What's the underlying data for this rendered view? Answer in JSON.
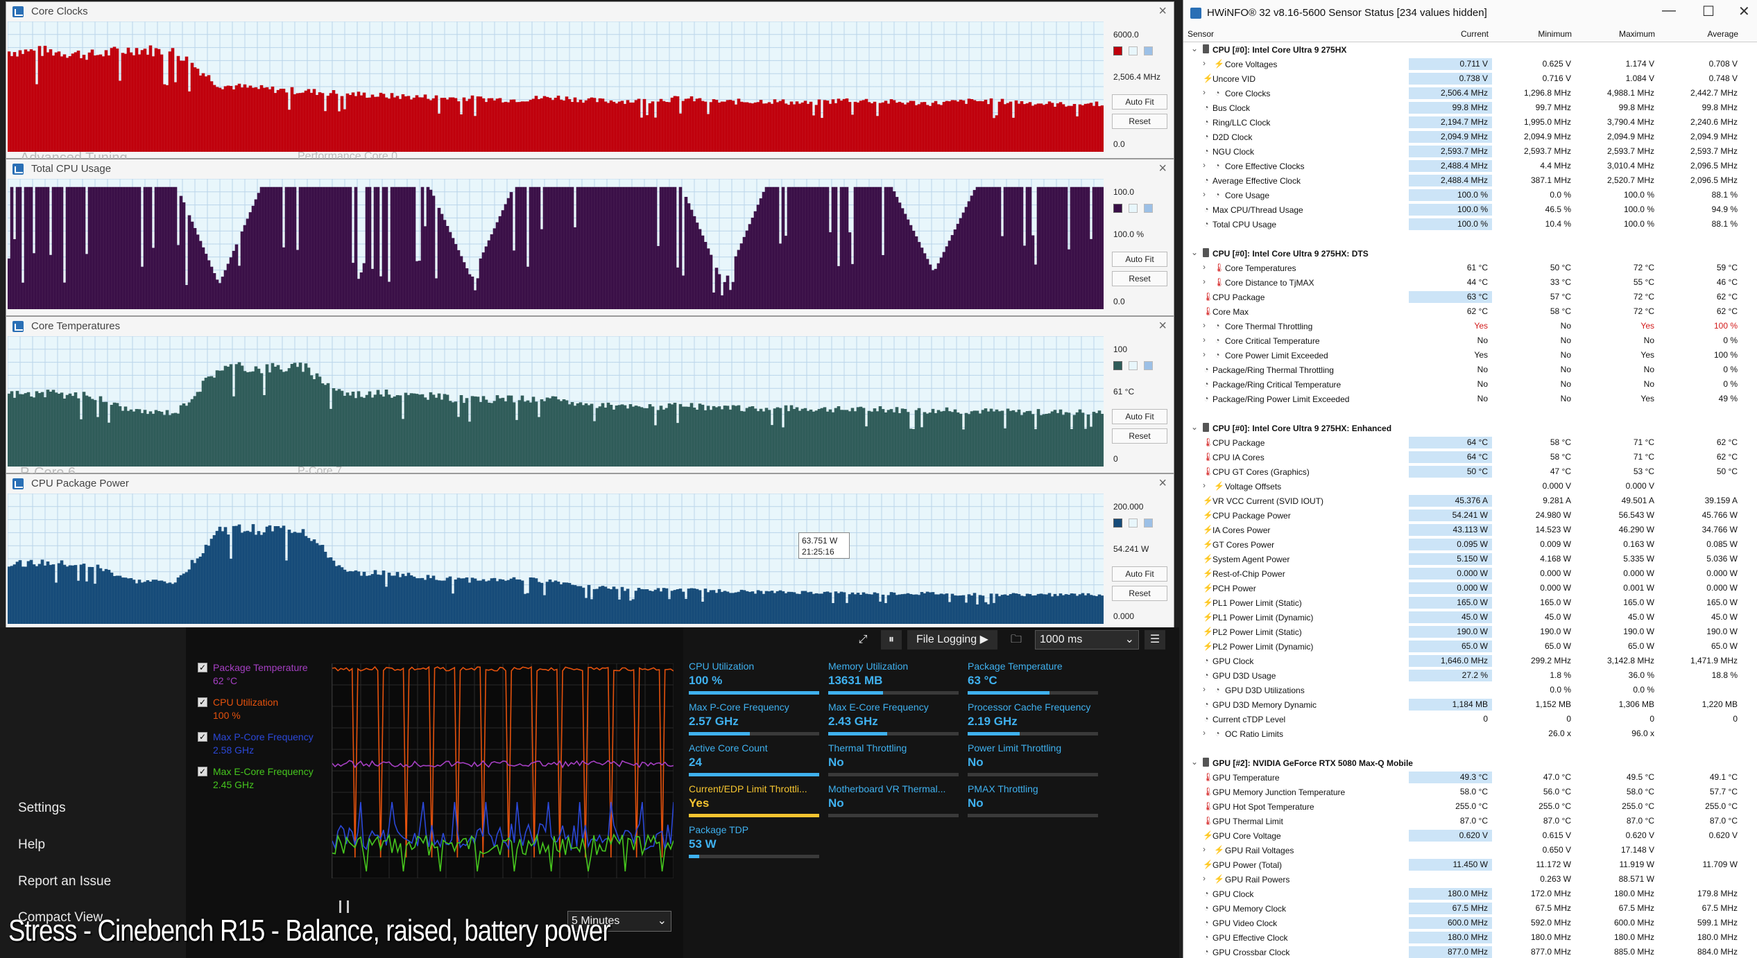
{
  "graphs": [
    {
      "title": "Core Clocks",
      "max": "6000.0",
      "current": "2,506.4 MHz",
      "min": "0.0",
      "auto_fit": "Auto Fit",
      "reset": "Reset",
      "color": "#c0000c",
      "bg_label": "Advanced Tuning",
      "bg_label2": "Performance Core 0",
      "level": [
        0.83,
        0.83,
        0.8,
        0.85,
        0.82,
        0.55,
        0.52,
        0.5,
        0.48,
        0.46,
        0.45,
        0.44,
        0.43,
        0.45,
        0.42,
        0.42,
        0.44,
        0.41,
        0.42,
        0.4,
        0.43,
        0.41,
        0.4,
        0.42,
        0.41,
        0.39,
        0.4
      ]
    },
    {
      "title": "Total CPU Usage",
      "max": "100.0",
      "current": "100.0 %",
      "min": "0.0",
      "auto_fit": "Auto Fit",
      "reset": "Reset",
      "color": "#3a0f47",
      "bg_label": "",
      "bg_label2": "",
      "level": [
        1,
        1,
        1,
        1,
        1,
        0.2,
        1,
        1,
        1,
        1,
        1,
        0.25,
        1,
        1,
        1,
        1,
        1,
        0.2,
        1,
        1,
        1,
        1,
        0.3,
        1,
        1,
        1,
        1
      ]
    },
    {
      "title": "Core Temperatures",
      "max": "100",
      "current": "61 °C",
      "min": "0",
      "auto_fit": "Auto Fit",
      "reset": "Reset",
      "color": "#2f5c59",
      "bg_label": "P-Core 6",
      "bg_label2": "P-Core 7",
      "level": [
        0.6,
        0.6,
        0.58,
        0.45,
        0.45,
        0.82,
        0.82,
        0.82,
        0.6,
        0.6,
        0.58,
        0.55,
        0.56,
        0.55,
        0.5,
        0.49,
        0.5,
        0.48,
        0.48,
        0.48,
        0.47,
        0.47,
        0.46,
        0.46,
        0.45,
        0.45,
        0.45
      ]
    },
    {
      "title": "CPU Package Power",
      "max": "200.000",
      "current": "54.241 W",
      "min": "0.000",
      "auto_fit": "Auto Fit",
      "reset": "Reset",
      "color": "#164b79",
      "tooltip_value": "63.751 W",
      "tooltip_time": "21:25:16",
      "bg_label": "",
      "bg_label2": "",
      "level": [
        0.5,
        0.5,
        0.48,
        0.35,
        0.35,
        0.78,
        0.78,
        0.78,
        0.42,
        0.42,
        0.38,
        0.36,
        0.37,
        0.35,
        0.3,
        0.28,
        0.28,
        0.27,
        0.26,
        0.26,
        0.25,
        0.25,
        0.25,
        0.24,
        0.24,
        0.24,
        0.24
      ]
    }
  ],
  "app": {
    "nav": [
      "Settings",
      "Help",
      "Report an Issue",
      "Compact View"
    ],
    "legend": [
      {
        "name": "Package Temperature",
        "value": "62 °C",
        "color": "#a53fc2"
      },
      {
        "name": "CPU Utilization",
        "value": "100 %",
        "color": "#e5520d"
      },
      {
        "name": "Max P-Core Frequency",
        "value": "2.58 GHz",
        "color": "#2b48d8"
      },
      {
        "name": "Max E-Core Frequency",
        "value": "2.45 GHz",
        "color": "#46c61e"
      }
    ],
    "toolbar": {
      "logging": "File Logging ▶",
      "interval": "1000 ms"
    },
    "time_range": "5 Minutes",
    "tiles": [
      {
        "label": "CPU Utilization",
        "value": "100 %",
        "fill": 1.0
      },
      {
        "label": "Memory Utilization",
        "value": "13631 MB",
        "fill": 0.42
      },
      {
        "label": "Package Temperature",
        "value": "63 °C",
        "fill": 0.63
      },
      {
        "label": "Max P-Core Frequency",
        "value": "2.57 GHz",
        "fill": 0.47
      },
      {
        "label": "Max E-Core Frequency",
        "value": "2.43 GHz",
        "fill": 0.45
      },
      {
        "label": "Processor Cache Frequency",
        "value": "2.19 GHz",
        "fill": 0.4
      },
      {
        "label": "Active Core Count",
        "value": "24",
        "fill": 1.0
      },
      {
        "label": "Thermal Throttling",
        "value": "No",
        "fill": 0
      },
      {
        "label": "Power Limit Throttling",
        "value": "No",
        "fill": 0
      },
      {
        "label": "Current/EDP Limit Throttli...",
        "value": "Yes",
        "fill": 1.0,
        "warn": true
      },
      {
        "label": "Motherboard VR Thermal...",
        "value": "No",
        "fill": 0
      },
      {
        "label": "PMAX Throttling",
        "value": "No",
        "fill": 0
      },
      {
        "label": "Package TDP",
        "value": "53 W",
        "fill": 0.08
      }
    ]
  },
  "caption": "Stress - Cinebench R15 - Balance, raised, battery power",
  "hwinfo": {
    "title": "HWiNFO® 32 v8.16-5600 Sensor Status [234 values hidden]",
    "columns": [
      "Sensor",
      "Current",
      "Minimum",
      "Maximum",
      "Average"
    ],
    "rows": [
      {
        "t": "g",
        "n": "CPU [#0]: Intel Core Ultra 9 275HX"
      },
      {
        "e": 1,
        "i": "bolt",
        "n": "Core Voltages",
        "c": "0.711 V",
        "mi": "0.625 V",
        "ma": "1.174 V",
        "a": "0.708 V",
        "h": 1
      },
      {
        "i": "bolt",
        "n": "Uncore VID",
        "c": "0.738 V",
        "mi": "0.716 V",
        "ma": "1.084 V",
        "a": "0.748 V",
        "h": 1
      },
      {
        "e": 1,
        "i": "clk",
        "n": "Core Clocks",
        "c": "2,506.4 MHz",
        "mi": "1,296.8 MHz",
        "ma": "4,988.1 MHz",
        "a": "2,442.7 MHz",
        "h": 1
      },
      {
        "i": "clk",
        "n": "Bus Clock",
        "c": "99.8 MHz",
        "mi": "99.7 MHz",
        "ma": "99.8 MHz",
        "a": "99.8 MHz",
        "h": 1
      },
      {
        "i": "clk",
        "n": "Ring/LLC Clock",
        "c": "2,194.7 MHz",
        "mi": "1,995.0 MHz",
        "ma": "3,790.4 MHz",
        "a": "2,240.6 MHz",
        "h": 1
      },
      {
        "i": "clk",
        "n": "D2D Clock",
        "c": "2,094.9 MHz",
        "mi": "2,094.9 MHz",
        "ma": "2,094.9 MHz",
        "a": "2,094.9 MHz",
        "h": 1
      },
      {
        "i": "clk",
        "n": "NGU Clock",
        "c": "2,593.7 MHz",
        "mi": "2,593.7 MHz",
        "ma": "2,593.7 MHz",
        "a": "2,593.7 MHz",
        "h": 1
      },
      {
        "e": 1,
        "i": "clk",
        "n": "Core Effective Clocks",
        "c": "2,488.4 MHz",
        "mi": "4.4 MHz",
        "ma": "3,010.4 MHz",
        "a": "2,096.5 MHz",
        "h": 1
      },
      {
        "i": "clk",
        "n": "Average Effective Clock",
        "c": "2,488.4 MHz",
        "mi": "387.1 MHz",
        "ma": "2,520.7 MHz",
        "a": "2,096.5 MHz",
        "h": 1
      },
      {
        "e": 1,
        "i": "clk",
        "n": "Core Usage",
        "c": "100.0 %",
        "mi": "0.0 %",
        "ma": "100.0 %",
        "a": "88.1 %",
        "h": 1
      },
      {
        "i": "clk",
        "n": "Max CPU/Thread Usage",
        "c": "100.0 %",
        "mi": "46.5 %",
        "ma": "100.0 %",
        "a": "94.9 %",
        "h": 1
      },
      {
        "i": "clk",
        "n": "Total CPU Usage",
        "c": "100.0 %",
        "mi": "10.4 %",
        "ma": "100.0 %",
        "a": "88.1 %",
        "h": 1
      },
      {
        "t": "s"
      },
      {
        "t": "g",
        "n": "CPU [#0]: Intel Core Ultra 9 275HX: DTS"
      },
      {
        "e": 1,
        "i": "temp",
        "n": "Core Temperatures",
        "c": "61 °C",
        "mi": "50 °C",
        "ma": "72 °C",
        "a": "59 °C"
      },
      {
        "e": 1,
        "i": "temp",
        "n": "Core Distance to TjMAX",
        "c": "44 °C",
        "mi": "33 °C",
        "ma": "55 °C",
        "a": "46 °C"
      },
      {
        "i": "temp",
        "n": "CPU Package",
        "c": "63 °C",
        "mi": "57 °C",
        "ma": "72 °C",
        "a": "62 °C",
        "h": 1
      },
      {
        "i": "temp",
        "n": "Core Max",
        "c": "62 °C",
        "mi": "58 °C",
        "ma": "72 °C",
        "a": "62 °C"
      },
      {
        "e": 1,
        "i": "clk",
        "n": "Core Thermal Throttling",
        "c": "Yes",
        "mi": "No",
        "ma": "Yes",
        "a": "100 %",
        "r": 1
      },
      {
        "e": 1,
        "i": "clk",
        "n": "Core Critical Temperature",
        "c": "No",
        "mi": "No",
        "ma": "No",
        "a": "0 %"
      },
      {
        "e": 1,
        "i": "clk",
        "n": "Core Power Limit Exceeded",
        "c": "Yes",
        "mi": "No",
        "ma": "Yes",
        "a": "100 %"
      },
      {
        "i": "clk",
        "n": "Package/Ring Thermal Throttling",
        "c": "No",
        "mi": "No",
        "ma": "No",
        "a": "0 %"
      },
      {
        "i": "clk",
        "n": "Package/Ring Critical Temperature",
        "c": "No",
        "mi": "No",
        "ma": "No",
        "a": "0 %"
      },
      {
        "i": "clk",
        "n": "Package/Ring Power Limit Exceeded",
        "c": "No",
        "mi": "No",
        "ma": "Yes",
        "a": "49 %"
      },
      {
        "t": "s"
      },
      {
        "t": "g",
        "n": "CPU [#0]: Intel Core Ultra 9 275HX: Enhanced"
      },
      {
        "i": "temp",
        "n": "CPU Package",
        "c": "64 °C",
        "mi": "58 °C",
        "ma": "71 °C",
        "a": "62 °C",
        "h": 1
      },
      {
        "i": "temp",
        "n": "CPU IA Cores",
        "c": "64 °C",
        "mi": "58 °C",
        "ma": "71 °C",
        "a": "62 °C",
        "h": 1
      },
      {
        "i": "temp",
        "n": "CPU GT Cores (Graphics)",
        "c": "50 °C",
        "mi": "47 °C",
        "ma": "53 °C",
        "a": "50 °C",
        "h": 1
      },
      {
        "e": 1,
        "i": "bolt",
        "n": "Voltage Offsets",
        "c": "",
        "mi": "0.000 V",
        "ma": "0.000 V",
        "a": ""
      },
      {
        "i": "bolt",
        "n": "VR VCC Current (SVID IOUT)",
        "c": "45.376 A",
        "mi": "9.281 A",
        "ma": "49.501 A",
        "a": "39.159 A",
        "h": 1
      },
      {
        "i": "bolt",
        "n": "CPU Package Power",
        "c": "54.241 W",
        "mi": "24.980 W",
        "ma": "56.543 W",
        "a": "45.766 W",
        "h": 1
      },
      {
        "i": "bolt",
        "n": "IA Cores Power",
        "c": "43.113 W",
        "mi": "14.523 W",
        "ma": "46.290 W",
        "a": "34.766 W",
        "h": 1
      },
      {
        "i": "bolt",
        "n": "GT Cores Power",
        "c": "0.095 W",
        "mi": "0.009 W",
        "ma": "0.163 W",
        "a": "0.085 W",
        "h": 1
      },
      {
        "i": "bolt",
        "n": "System Agent Power",
        "c": "5.150 W",
        "mi": "4.168 W",
        "ma": "5.335 W",
        "a": "5.036 W",
        "h": 1
      },
      {
        "i": "bolt",
        "n": "Rest-of-Chip Power",
        "c": "0.000 W",
        "mi": "0.000 W",
        "ma": "0.000 W",
        "a": "0.000 W",
        "h": 1
      },
      {
        "i": "bolt",
        "n": "PCH Power",
        "c": "0.000 W",
        "mi": "0.000 W",
        "ma": "0.001 W",
        "a": "0.000 W",
        "h": 1
      },
      {
        "i": "bolt",
        "n": "PL1 Power Limit (Static)",
        "c": "165.0 W",
        "mi": "165.0 W",
        "ma": "165.0 W",
        "a": "165.0 W",
        "h": 1
      },
      {
        "i": "bolt",
        "n": "PL1 Power Limit (Dynamic)",
        "c": "45.0 W",
        "mi": "45.0 W",
        "ma": "45.0 W",
        "a": "45.0 W",
        "h": 1
      },
      {
        "i": "bolt",
        "n": "PL2 Power Limit (Static)",
        "c": "190.0 W",
        "mi": "190.0 W",
        "ma": "190.0 W",
        "a": "190.0 W",
        "h": 1
      },
      {
        "i": "bolt",
        "n": "PL2 Power Limit (Dynamic)",
        "c": "65.0 W",
        "mi": "65.0 W",
        "ma": "65.0 W",
        "a": "65.0 W",
        "h": 1
      },
      {
        "i": "clk",
        "n": "GPU Clock",
        "c": "1,646.0 MHz",
        "mi": "299.2 MHz",
        "ma": "3,142.8 MHz",
        "a": "1,471.9 MHz",
        "h": 1
      },
      {
        "i": "clk",
        "n": "GPU D3D Usage",
        "c": "27.2 %",
        "mi": "1.8 %",
        "ma": "36.0 %",
        "a": "18.8 %",
        "h": 1
      },
      {
        "e": 1,
        "i": "clk",
        "n": "GPU D3D Utilizations",
        "c": "",
        "mi": "0.0 %",
        "ma": "0.0 %",
        "a": ""
      },
      {
        "i": "clk",
        "n": "GPU D3D Memory Dynamic",
        "c": "1,184 MB",
        "mi": "1,152 MB",
        "ma": "1,306 MB",
        "a": "1,220 MB",
        "h": 1
      },
      {
        "i": "clk",
        "n": "Current cTDP Level",
        "c": "0",
        "mi": "0",
        "ma": "0",
        "a": "0"
      },
      {
        "e": 1,
        "i": "clk",
        "n": "OC Ratio Limits",
        "c": "",
        "mi": "26.0 x",
        "ma": "96.0 x",
        "a": ""
      },
      {
        "t": "s"
      },
      {
        "t": "g",
        "n": "GPU [#2]: NVIDIA GeForce RTX 5080 Max-Q Mobile"
      },
      {
        "i": "temp",
        "n": "GPU Temperature",
        "c": "49.3 °C",
        "mi": "47.0 °C",
        "ma": "49.5 °C",
        "a": "49.1 °C",
        "h": 1
      },
      {
        "i": "temp",
        "n": "GPU Memory Junction Temperature",
        "c": "58.0 °C",
        "mi": "56.0 °C",
        "ma": "58.0 °C",
        "a": "57.7 °C"
      },
      {
        "i": "temp",
        "n": "GPU Hot Spot Temperature",
        "c": "255.0 °C",
        "mi": "255.0 °C",
        "ma": "255.0 °C",
        "a": "255.0 °C"
      },
      {
        "i": "temp",
        "n": "GPU Thermal Limit",
        "c": "87.0 °C",
        "mi": "87.0 °C",
        "ma": "87.0 °C",
        "a": "87.0 °C"
      },
      {
        "i": "bolt",
        "n": "GPU Core Voltage",
        "c": "0.620 V",
        "mi": "0.615 V",
        "ma": "0.620 V",
        "a": "0.620 V",
        "h": 1
      },
      {
        "e": 1,
        "i": "bolt",
        "n": "GPU Rail Voltages",
        "c": "",
        "mi": "0.650 V",
        "ma": "17.148 V",
        "a": ""
      },
      {
        "i": "bolt",
        "n": "GPU Power (Total)",
        "c": "11.450 W",
        "mi": "11.172 W",
        "ma": "11.919 W",
        "a": "11.709 W",
        "h": 1
      },
      {
        "e": 1,
        "i": "bolt",
        "n": "GPU Rail Powers",
        "c": "",
        "mi": "0.263 W",
        "ma": "88.571 W",
        "a": ""
      },
      {
        "i": "clk",
        "n": "GPU Clock",
        "c": "180.0 MHz",
        "mi": "172.0 MHz",
        "ma": "180.0 MHz",
        "a": "179.8 MHz",
        "h": 1
      },
      {
        "i": "clk",
        "n": "GPU Memory Clock",
        "c": "67.5 MHz",
        "mi": "67.5 MHz",
        "ma": "67.5 MHz",
        "a": "67.5 MHz",
        "h": 1
      },
      {
        "i": "clk",
        "n": "GPU Video Clock",
        "c": "600.0 MHz",
        "mi": "592.0 MHz",
        "ma": "600.0 MHz",
        "a": "599.1 MHz",
        "h": 1
      },
      {
        "i": "clk",
        "n": "GPU Effective Clock",
        "c": "180.0 MHz",
        "mi": "180.0 MHz",
        "ma": "180.0 MHz",
        "a": "180.0 MHz",
        "h": 1
      },
      {
        "i": "clk",
        "n": "GPU Crossbar Clock",
        "c": "877.0 MHz",
        "mi": "877.0 MHz",
        "ma": "885.0 MHz",
        "a": "884.0 MHz",
        "h": 1
      }
    ]
  }
}
